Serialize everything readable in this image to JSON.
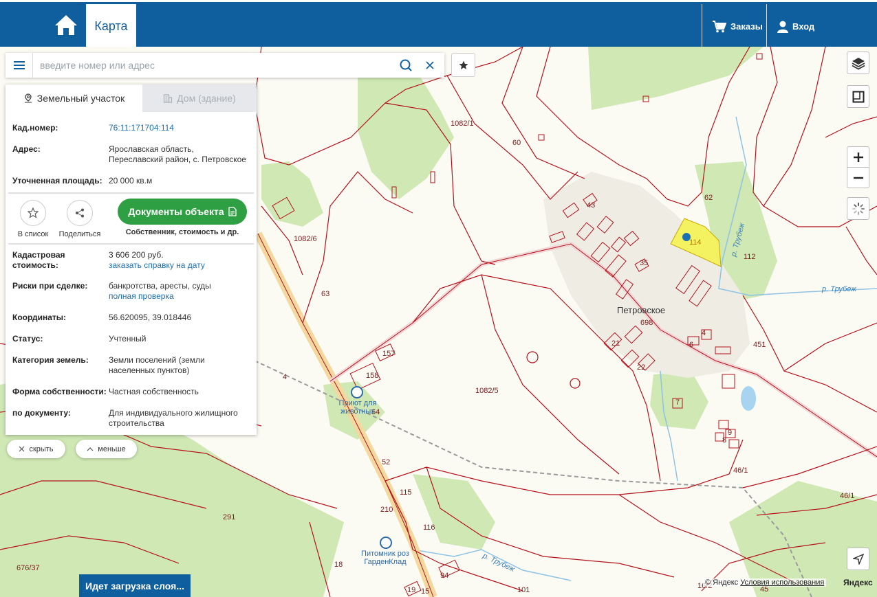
{
  "header": {
    "map_tab": "Карта",
    "orders_label": "Заказы",
    "login_label": "Вход"
  },
  "search": {
    "placeholder": "введите номер или адрес"
  },
  "panel": {
    "tab_land": "Земельный участок",
    "tab_house": "Дом (здание)",
    "cad_number_key": "Кад.номер:",
    "cad_number_val": "76:11:171704:114",
    "address_key": "Адрес:",
    "address_val": "Ярославская область, Переславский район, с. Петровское",
    "area_key": "Уточненная площадь:",
    "area_val": "20 000 кв.м",
    "action_list": "В список",
    "action_share": "Поделиться",
    "docs_button": "Документы объекта",
    "docs_sub": "Собственник, стоимость и др.",
    "cost_key": "Кадастровая стоимость:",
    "cost_val": "3 606 200 руб.",
    "cost_link": "заказать справку на дату",
    "risk_key": "Риски при сделке:",
    "risk_val": "банкротства, аресты, суды",
    "risk_link": "полная проверка",
    "coords_key": "Координаты:",
    "coords_val": "56.620095, 39.018446",
    "status_key": "Статус:",
    "status_val": "Учтенный",
    "category_key": "Категория земель:",
    "category_val": "Земли поселений (земли населенных пунктов)",
    "ownership_key": "Форма собственности:",
    "ownership_val": "Частная собственность",
    "bydoc_key": "по документу:",
    "bydoc_val": "Для индивидуального жилищного строительства"
  },
  "pills": {
    "hide": "скрыть",
    "less": "меньше"
  },
  "loading": "Идет загрузка слоя...",
  "attribution": {
    "copyright": "© Яндекс",
    "terms": "Условия использования",
    "logo": "Яндекс"
  },
  "map": {
    "place": "Петровское",
    "parcels": [
      "1082/1",
      "1082/6",
      "1082/5",
      "114",
      "62",
      "112",
      "451",
      "46/1",
      "46/1",
      "291",
      "676/37",
      "18",
      "116",
      "115",
      "52",
      "64",
      "158",
      "157",
      "43",
      "35",
      "21",
      "22",
      "4",
      "6",
      "7",
      "9",
      "8",
      "60",
      "63",
      "698",
      "210",
      "94",
      "19",
      "15",
      "101",
      "16/2",
      "45",
      "4"
    ],
    "water": [
      "р. Трубеж",
      "р. Трубеж",
      "р. Трубеж"
    ],
    "poi": [
      "Приют для животных",
      "Питомник роз ГарденКлад"
    ]
  },
  "colors": {
    "header_bg": "#0f5f9f",
    "parcel_line": "#b5121b",
    "selected_parcel": "#f5f262",
    "green_area": "#cfe8b4",
    "docs_button": "#2ea043"
  }
}
